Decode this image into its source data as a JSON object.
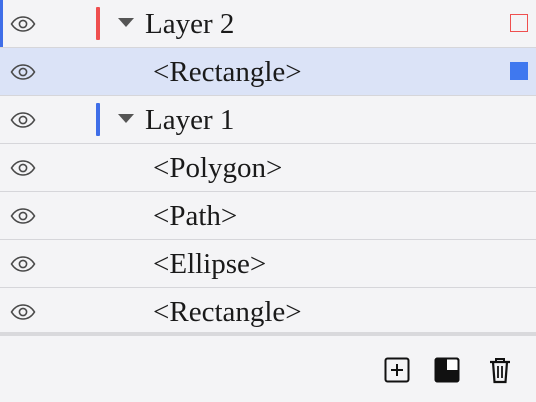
{
  "layers": [
    {
      "name": "Layer 2",
      "kind": "layer",
      "color": "#ef4f4f",
      "expanded": true,
      "visible": true,
      "active": true,
      "target": "outline",
      "children": [
        {
          "name": "<Rectangle>",
          "selected": true,
          "target": "filled",
          "target_color": "#3f78ef",
          "visible": true
        }
      ]
    },
    {
      "name": "Layer 1",
      "kind": "layer",
      "color": "#3f6ee8",
      "expanded": true,
      "visible": true,
      "active": false,
      "children": [
        {
          "name": "<Polygon>",
          "visible": true
        },
        {
          "name": "<Path>",
          "visible": true
        },
        {
          "name": "<Ellipse>",
          "visible": true
        },
        {
          "name": "<Rectangle>",
          "visible": true
        }
      ]
    }
  ],
  "icons": {
    "visibility": "eye-icon",
    "expand": "caret-down-icon",
    "new_layer": "add-layer-icon",
    "mask": "clipping-mask-icon",
    "delete": "trash-icon"
  },
  "colors": {
    "panel_bg": "#f4f4f6",
    "selection_bg": "#dbe3f7",
    "active_edge": "#3f6ee8"
  }
}
